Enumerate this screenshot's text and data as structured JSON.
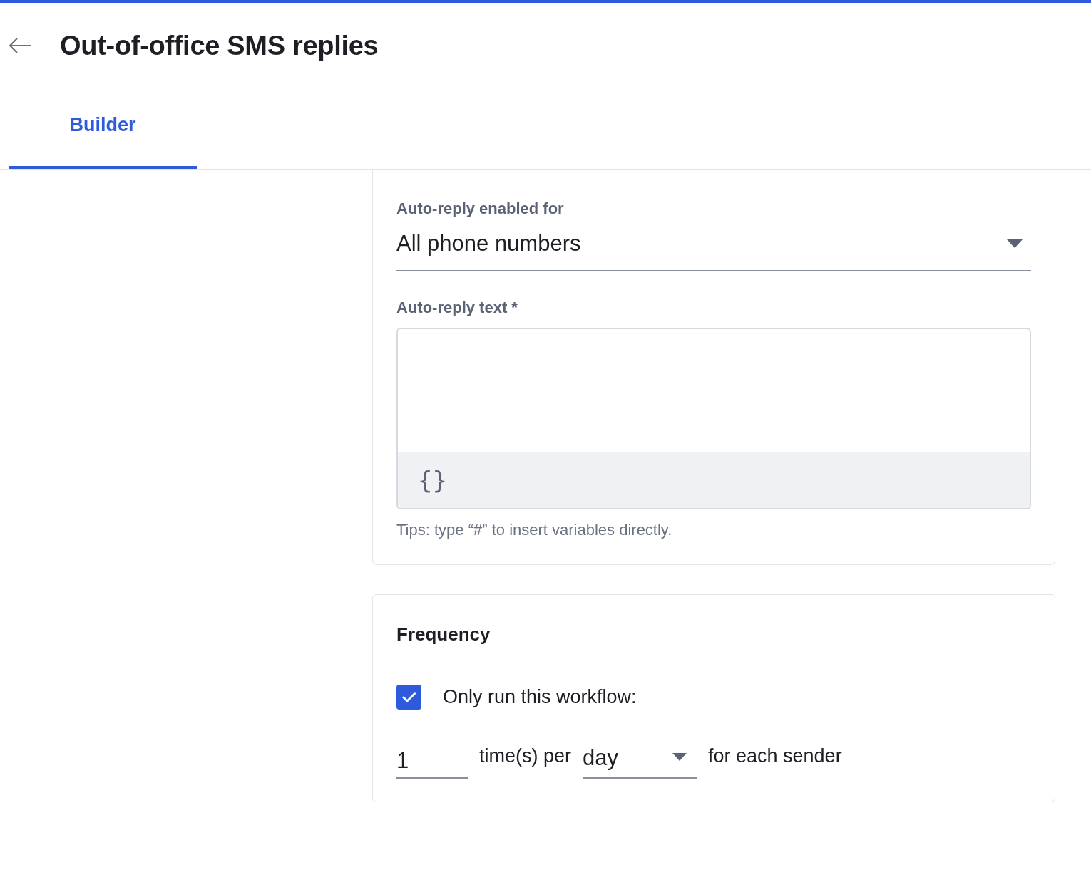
{
  "header": {
    "title": "Out-of-office SMS replies"
  },
  "tabs": [
    {
      "label": "Builder",
      "selected": true
    }
  ],
  "reply_card": {
    "recipients_label": "Auto-reply enabled for",
    "recipients_value": "All phone numbers",
    "text_label": "Auto-reply text *",
    "variables_button": "{}",
    "tip": "Tips: type “#” to insert variables directly."
  },
  "frequency_card": {
    "title": "Frequency",
    "limit": {
      "label": "Only run this workflow:",
      "checked": true
    },
    "count": "1",
    "count_suffix": "time(s) per",
    "period": "day",
    "period_suffix": "for each sender"
  }
}
